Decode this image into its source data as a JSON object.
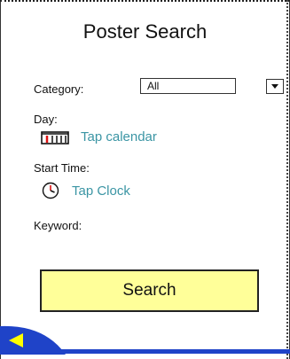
{
  "header": {
    "title": "Poster Search"
  },
  "form": {
    "category_label": "Category:",
    "category_value": "All",
    "day_label": "Day:",
    "day_action": "Tap calendar",
    "start_time_label": "Start Time:",
    "start_time_action": "Tap Clock",
    "keyword_label": "Keyword:"
  },
  "actions": {
    "search_label": "Search"
  },
  "icons": {
    "calendar": "calendar-icon",
    "clock": "clock-icon",
    "dropdown": "chevron-down-icon",
    "back": "left-arrow-icon"
  },
  "colors": {
    "link": "#3b95a4",
    "search_fill": "#ffff99",
    "bottom_bar": "#1f43c8",
    "back_arrow": "#ffff00"
  }
}
